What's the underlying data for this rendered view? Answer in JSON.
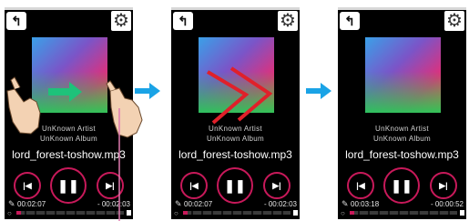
{
  "screens": [
    {
      "artist": "UnKnown Artist",
      "album": "UnKnown Album",
      "title": "lord_forest-toshow.mp3",
      "elapsed": "00:02:07",
      "remaining": "- 00:02:03",
      "progress": 0.04
    },
    {
      "artist": "UnKnown Artist",
      "album": "UnKnown Album",
      "title": "lord_forest-toshow.mp3",
      "elapsed": "00:02:07",
      "remaining": "- 00:02:03",
      "progress": 0.04
    },
    {
      "artist": "UnKnown Artist",
      "album": "UnKnown Album",
      "title": "lord_forest-toshow.mp3",
      "elapsed": "00:03:18",
      "remaining": "- 00:00:52",
      "progress": 0.04
    }
  ],
  "icons": {
    "back": "back-arrow-icon",
    "settings": "gear-icon",
    "prev": "skip-previous-icon",
    "pause": "pause-icon",
    "next": "skip-next-icon",
    "pin": "pin-icon",
    "loop": "loop-icon",
    "flow": "right-arrow-icon",
    "gesture": "hand-swipe-icon"
  },
  "colors": {
    "accent": "#c8195a",
    "flow_arrow": "#1aa3e6",
    "swipe_arrow": "#1ec27a",
    "chevron": "#e0202a"
  }
}
